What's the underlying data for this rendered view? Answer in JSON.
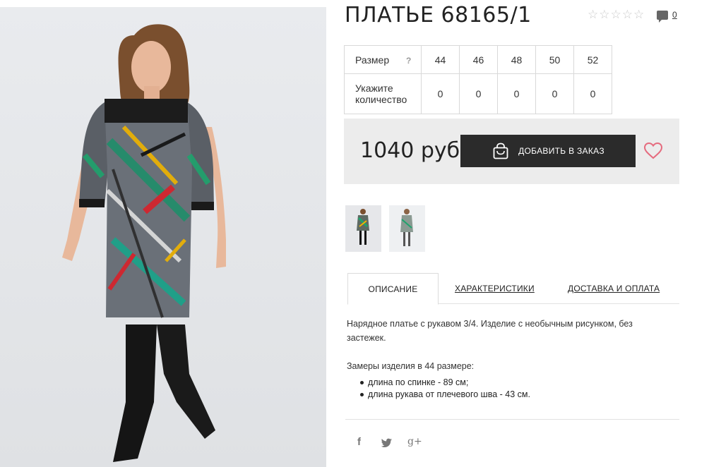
{
  "product": {
    "title": "ПЛАТЬЕ 68165/1",
    "rating": {
      "filled": 0,
      "max": 5
    },
    "reviews_count": "0"
  },
  "sizes": {
    "label": "Размер",
    "help": "?",
    "values": [
      "44",
      "46",
      "48",
      "50",
      "52"
    ],
    "qty_label": "Укажите количество",
    "quantities": [
      "0",
      "0",
      "0",
      "0",
      "0"
    ]
  },
  "purchase": {
    "price": "1040 руб",
    "add_button": "ДОБАВИТЬ В ЗАКАЗ",
    "icons": {
      "bag": "shopping-bag-icon",
      "wishlist": "heart-icon"
    }
  },
  "tabs": [
    "ОПИСАНИЕ",
    "ХАРАКТЕРИСТИКИ",
    "ДОСТАВКА И ОПЛАТА"
  ],
  "description": {
    "text": "Нарядное платье с рукавом 3/4. Изделие с необычным рисунком, без застежек.",
    "measure_title": "Замеры изделия в 44 размере:",
    "measures": [
      "длина по спинке - 89 см;",
      "длина рукава от плечевого шва - 43 см."
    ]
  },
  "social": {
    "fb": "f",
    "tw": "🐦",
    "gp": "g+"
  },
  "colors": {
    "accent": "#2b2b2b",
    "heart": "#e56b7e",
    "panel": "#ececec"
  }
}
